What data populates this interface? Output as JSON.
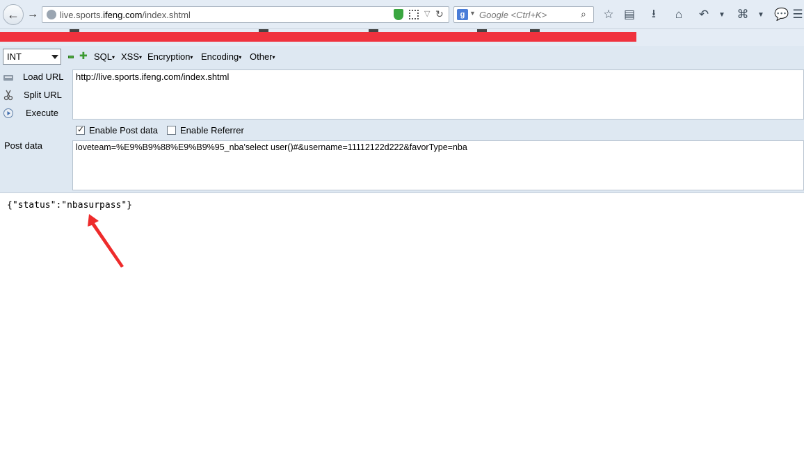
{
  "browser": {
    "url_host": "live.sports.",
    "url_domain": "ifeng.com",
    "url_path": "/index.shtml",
    "search_placeholder": "Google <Ctrl+K>",
    "search_engine_letter": "g",
    "icons": [
      "back-arrow-icon",
      "forward-arrow-icon",
      "globe-icon",
      "shield-icon",
      "qr-code-icon",
      "dropdown-icon",
      "reload-icon",
      "search-icon",
      "bookmark-star-icon",
      "reading-list-icon",
      "download-icon",
      "home-icon",
      "undo-icon",
      "crop-icon",
      "chat-icon",
      "menu-icon"
    ]
  },
  "hackbar": {
    "select_value": "INT",
    "menus": [
      "SQL",
      "XSS",
      "Encryption",
      "Encoding",
      "Other"
    ],
    "load_url": "Load URL",
    "split_url": "Split URL",
    "execute": "Execute",
    "post_data_label": "Post data",
    "url_value": "http://live.sports.ifeng.com/index.shtml",
    "enable_post_label": "Enable Post data",
    "enable_post_checked": true,
    "enable_referrer_label": "Enable Referrer",
    "enable_referrer_checked": false,
    "post_value": "loveteam=%E9%B9%88%E9%B9%95_nba'select user()#&username=11112122d222&favorType=nba"
  },
  "page": {
    "response": "{\"status\":\"nbasurpass\"}",
    "annotation_color": "#ee2b2b"
  },
  "colors": {
    "redaction": "#f0323e",
    "toolbar_bg": "#dee8f2",
    "nav_bg": "#e4ecf5"
  }
}
